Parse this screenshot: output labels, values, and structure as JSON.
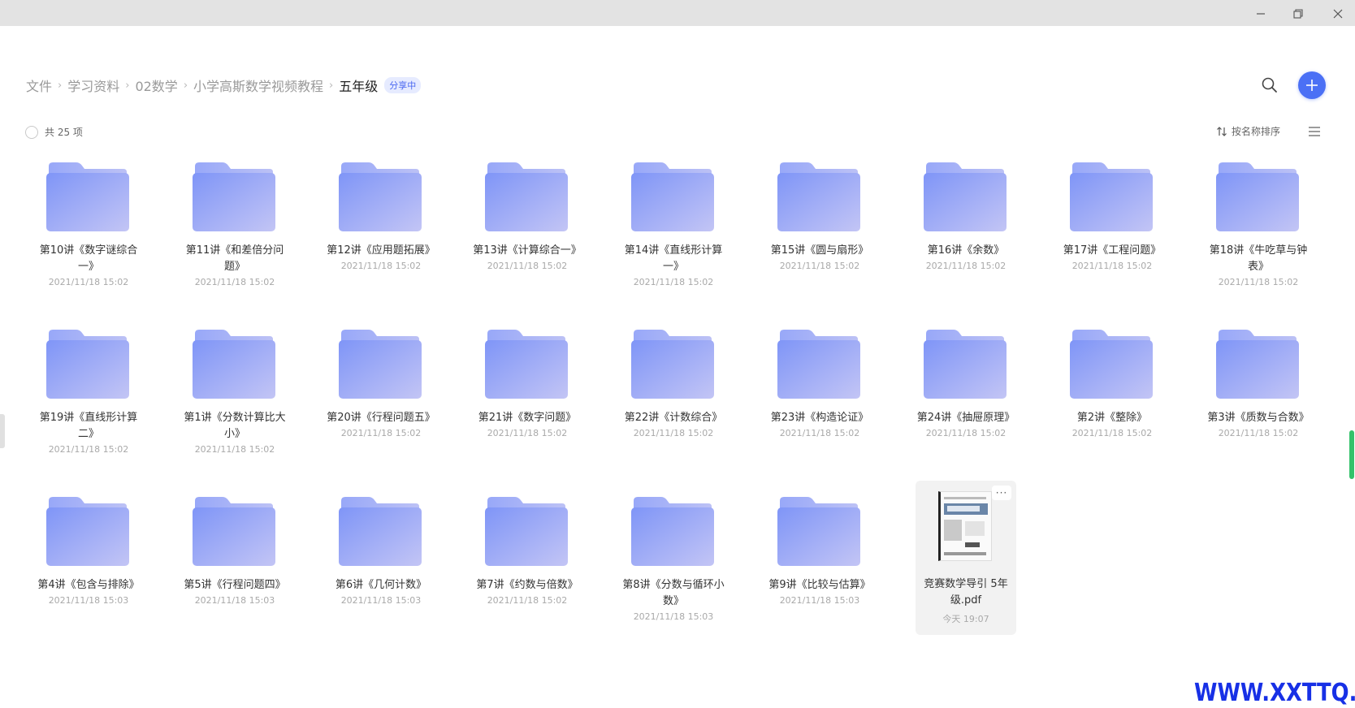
{
  "window": {
    "minimize_icon": "minimize-icon",
    "maximize_icon": "restore-icon",
    "close_icon": "close-icon"
  },
  "breadcrumb": {
    "items": [
      "文件",
      "学习资料",
      "02数学",
      "小学高斯数学视频教程"
    ],
    "current": "五年级",
    "badge": "分享中"
  },
  "toolbar": {
    "search_icon": "search-icon",
    "add_icon": "plus-icon",
    "accent_color": "#4b70f5"
  },
  "list_header": {
    "count_label": "共 25 项",
    "sort_label": "按名称排序",
    "sort_icon": "sort-arrows-icon",
    "view_icon": "list-view-icon"
  },
  "items": [
    {
      "name": "第10讲《数字谜综合一》",
      "time": "2021/11/18 15:02",
      "type": "folder"
    },
    {
      "name": "第11讲《和差倍分问题》",
      "time": "2021/11/18 15:02",
      "type": "folder"
    },
    {
      "name": "第12讲《应用题拓展》",
      "time": "2021/11/18 15:02",
      "type": "folder"
    },
    {
      "name": "第13讲《计算综合一》",
      "time": "2021/11/18 15:02",
      "type": "folder"
    },
    {
      "name": "第14讲《直线形计算一》",
      "time": "2021/11/18 15:02",
      "type": "folder"
    },
    {
      "name": "第15讲《圆与扇形》",
      "time": "2021/11/18 15:02",
      "type": "folder"
    },
    {
      "name": "第16讲《余数》",
      "time": "2021/11/18 15:02",
      "type": "folder"
    },
    {
      "name": "第17讲《工程问题》",
      "time": "2021/11/18 15:02",
      "type": "folder"
    },
    {
      "name": "第18讲《牛吃草与钟表》",
      "time": "2021/11/18 15:02",
      "type": "folder"
    },
    {
      "name": "第19讲《直线形计算二》",
      "time": "2021/11/18 15:02",
      "type": "folder"
    },
    {
      "name": "第1讲《分数计算比大小》",
      "time": "2021/11/18 15:02",
      "type": "folder"
    },
    {
      "name": "第20讲《行程问题五》",
      "time": "2021/11/18 15:02",
      "type": "folder"
    },
    {
      "name": "第21讲《数字问题》",
      "time": "2021/11/18 15:02",
      "type": "folder"
    },
    {
      "name": "第22讲《计数综合》",
      "time": "2021/11/18 15:02",
      "type": "folder"
    },
    {
      "name": "第23讲《构造论证》",
      "time": "2021/11/18 15:02",
      "type": "folder"
    },
    {
      "name": "第24讲《抽屉原理》",
      "time": "2021/11/18 15:02",
      "type": "folder"
    },
    {
      "name": "第2讲《整除》",
      "time": "2021/11/18 15:02",
      "type": "folder"
    },
    {
      "name": "第3讲《质数与合数》",
      "time": "2021/11/18 15:02",
      "type": "folder"
    },
    {
      "name": "第4讲《包含与排除》",
      "time": "2021/11/18 15:03",
      "type": "folder"
    },
    {
      "name": "第5讲《行程问题四》",
      "time": "2021/11/18 15:03",
      "type": "folder"
    },
    {
      "name": "第6讲《几何计数》",
      "time": "2021/11/18 15:03",
      "type": "folder"
    },
    {
      "name": "第7讲《约数与倍数》",
      "time": "2021/11/18 15:02",
      "type": "folder"
    },
    {
      "name": "第8讲《分数与循环小数》",
      "time": "2021/11/18 15:03",
      "type": "folder"
    },
    {
      "name": "第9讲《比较与估算》",
      "time": "2021/11/18 15:03",
      "type": "folder"
    },
    {
      "name": "竞赛数学导引 5年级.pdf",
      "time": "今天 19:07",
      "type": "pdf"
    }
  ],
  "folder_icon": "folder-icon",
  "pdf_icon": "pdf-thumbnail-icon",
  "pdf_more_label": "···",
  "watermark": "WWW.XXTTQ.COM"
}
